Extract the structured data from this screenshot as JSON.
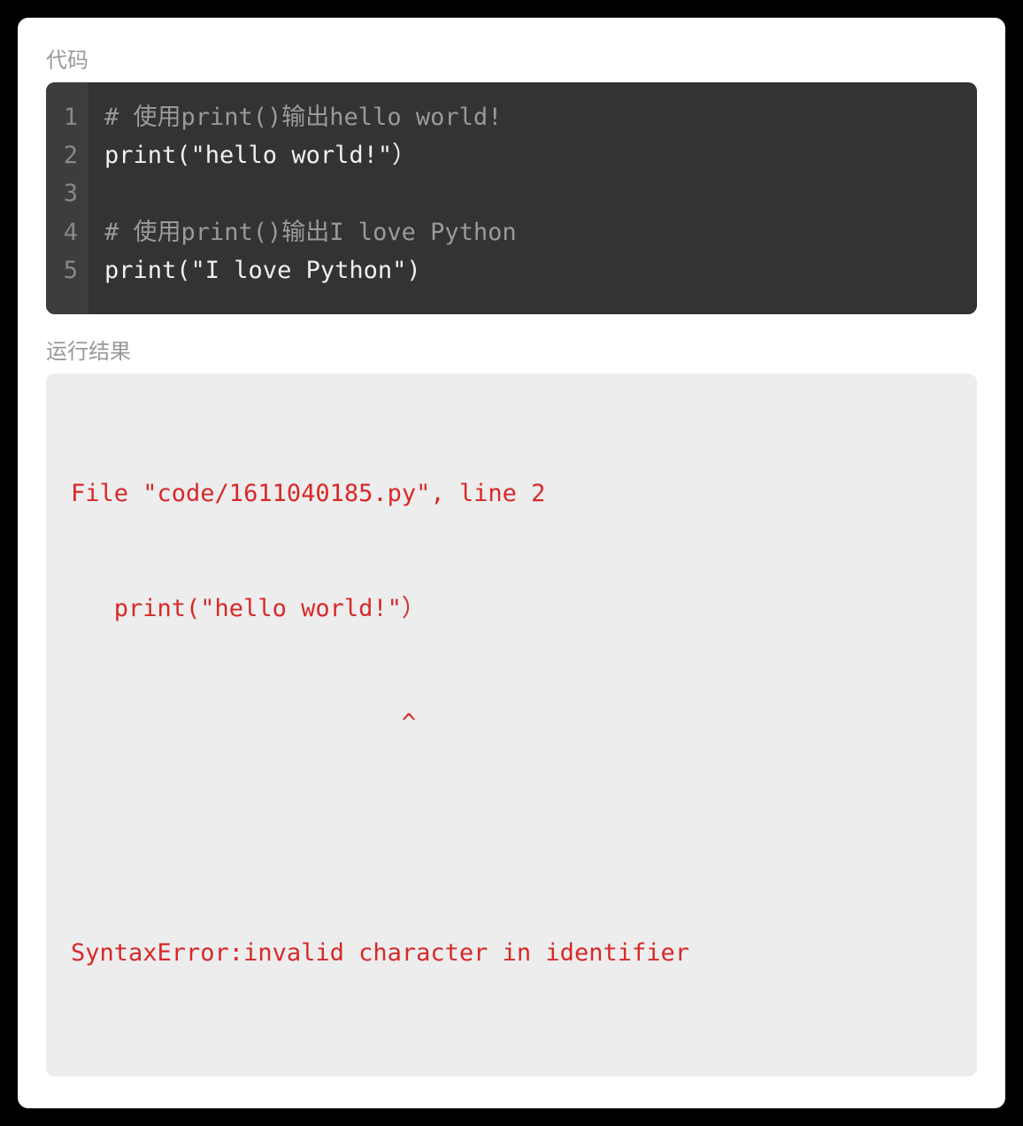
{
  "labels": {
    "code": "代码",
    "result": "运行结果"
  },
  "code": {
    "lines": [
      {
        "num": "1",
        "type": "comment",
        "text": "# 使用print()输出hello world!"
      },
      {
        "num": "2",
        "type": "code",
        "text": "print(\"hello world!\"）"
      },
      {
        "num": "3",
        "type": "code",
        "text": ""
      },
      {
        "num": "4",
        "type": "comment",
        "text": "# 使用print()输出I love Python"
      },
      {
        "num": "5",
        "type": "code",
        "text": "print(\"I love Python\")"
      }
    ]
  },
  "result": {
    "lines": [
      "File \"code/1611040185.py\", line 2",
      "   print(\"hello world!\"）",
      "                       ^",
      "",
      "SyntaxError:invalid character in identifier"
    ]
  }
}
